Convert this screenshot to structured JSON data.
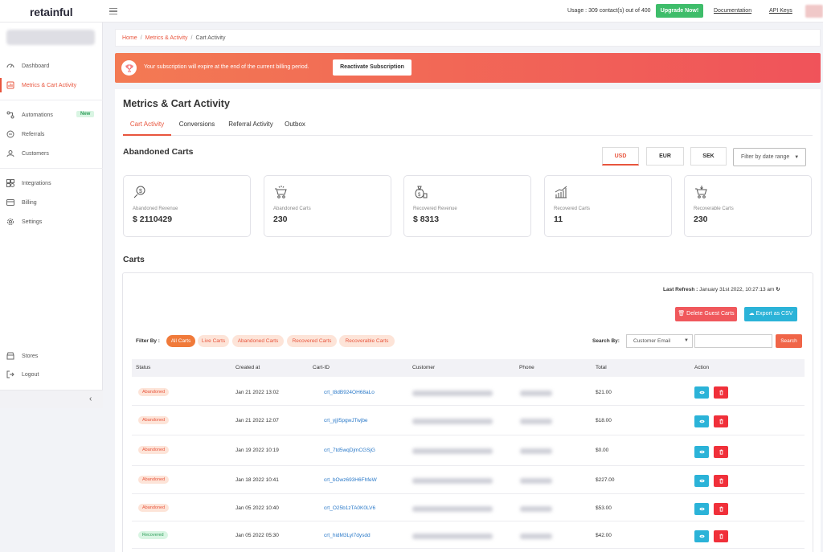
{
  "app": {
    "logo": "retainful"
  },
  "topbar": {
    "usage": "Usage : 309 contact(s) out of 400",
    "upgrade_label": "Upgrade Now!",
    "documentation_label": "Documentation",
    "api_keys_label": "API Keys"
  },
  "sidebar": {
    "items": [
      {
        "label": "Dashboard",
        "icon": "dashboard-icon"
      },
      {
        "label": "Metrics & Cart Activity",
        "icon": "metrics-icon",
        "active": true
      },
      {
        "label": "Automations",
        "icon": "automations-icon",
        "badge": "New"
      },
      {
        "label": "Referrals",
        "icon": "referrals-icon"
      },
      {
        "label": "Customers",
        "icon": "customers-icon"
      },
      {
        "label": "Integrations",
        "icon": "integrations-icon"
      },
      {
        "label": "Billing",
        "icon": "billing-icon"
      },
      {
        "label": "Settings",
        "icon": "settings-icon"
      },
      {
        "label": "Stores",
        "icon": "stores-icon"
      },
      {
        "label": "Logout",
        "icon": "logout-icon"
      }
    ],
    "collapse_icon": "chevron-left-icon"
  },
  "breadcrumb": {
    "home": "Home",
    "metrics": "Metrics & Activity",
    "current": "Cart Activity"
  },
  "banner": {
    "icon": "trophy-icon",
    "text": "Your subscription will expire at the end of the current billing period.",
    "button": "Reactivate Subscription"
  },
  "page": {
    "title": "Metrics & Cart Activity",
    "tabs": [
      "Cart Activity",
      "Conversions",
      "Referral Activity",
      "Outbox"
    ],
    "active_tab": "Cart Activity"
  },
  "abandoned": {
    "title": "Abandoned Carts",
    "currencies": [
      "USD",
      "EUR",
      "SEK"
    ],
    "active_currency": "USD",
    "date_filter": "Filter by date range",
    "cards": [
      {
        "label": "Abandoned Revenue",
        "value": "$ 2110429",
        "icon": "revenue-icon"
      },
      {
        "label": "Abandoned Carts",
        "value": "230",
        "icon": "cart-icon"
      },
      {
        "label": "Recovered Revenue",
        "value": "$ 8313",
        "icon": "money-bag-icon"
      },
      {
        "label": "Recovered Carts",
        "value": "11",
        "icon": "growth-chart-icon"
      },
      {
        "label": "Recoverable Carts",
        "value": "230",
        "icon": "cart-down-icon"
      }
    ]
  },
  "carts": {
    "title": "Carts",
    "last_refresh_label": "Last Refresh :",
    "last_refresh_value": "January 31st 2022, 10:27:13 am",
    "delete_guest_label": "Delete Guest Carts",
    "export_label": "Export as CSV",
    "filter_label": "Filter By :",
    "filters": [
      "All Carts",
      "Live Carts",
      "Abandoned Carts",
      "Recovered Carts",
      "Recoverable Carts"
    ],
    "active_filter": "All Carts",
    "search_label": "Search By:",
    "search_field": "Customer Email",
    "search_button": "Search",
    "columns": [
      "Status",
      "Created at",
      "Cart-ID",
      "Customer",
      "Phone",
      "Total",
      "Action"
    ],
    "rows": [
      {
        "status": "Abandoned",
        "created": "Jan 21 2022 13:02",
        "cart_id": "crt_t8dB924OH68aLo",
        "total": "$21.00"
      },
      {
        "status": "Abandoned",
        "created": "Jan 21 2022 12:07",
        "cart_id": "crt_yjjI5pgwJTwjbe",
        "total": "$18.00"
      },
      {
        "status": "Abandoned",
        "created": "Jan 19 2022 10:19",
        "cart_id": "crt_7td5wqDjmCGSjG",
        "total": "$0.00"
      },
      {
        "status": "Abandoned",
        "created": "Jan 18 2022 10:41",
        "cart_id": "crt_bOwz693H6FhfeW",
        "total": "$227.00"
      },
      {
        "status": "Abandoned",
        "created": "Jan 05 2022 10:40",
        "cart_id": "crt_O25b1zTA0K0LV6",
        "total": "$53.00"
      },
      {
        "status": "Recovered",
        "created": "Jan 05 2022 05:30",
        "cart_id": "crt_hidM3Lyl7dysdd",
        "total": "$42.00"
      }
    ]
  },
  "colors": {
    "accent": "#e8553d",
    "success": "#3ebd6a",
    "info": "#2bb3d8",
    "danger": "#f0303a"
  }
}
